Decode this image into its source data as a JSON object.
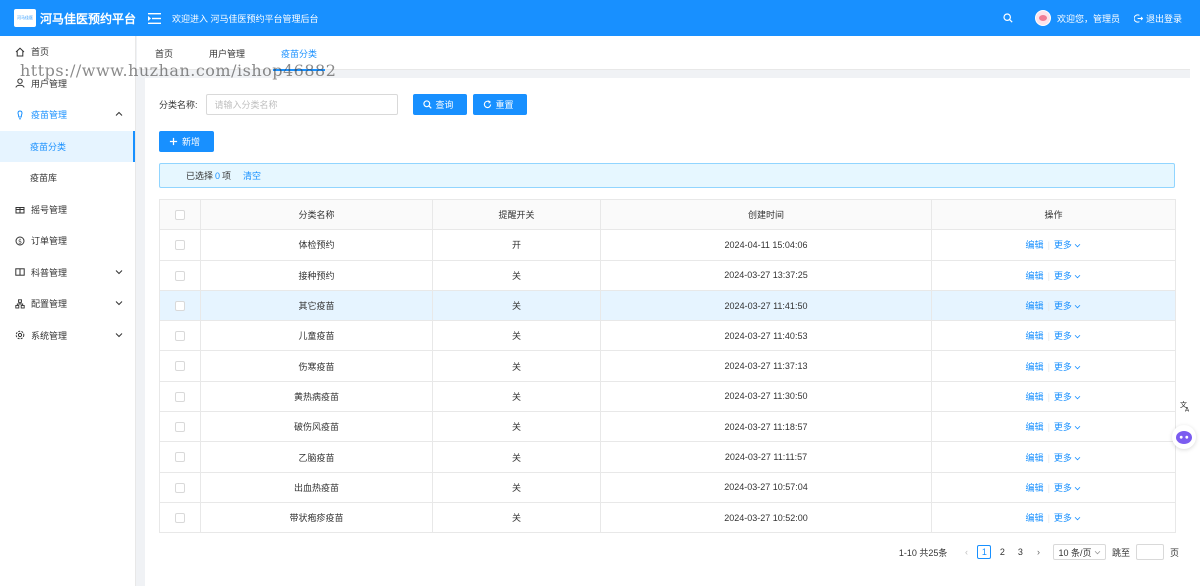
{
  "header": {
    "logo_text": "河马佳医",
    "title": "河马佳医预约平台",
    "welcome": "欢迎进入 河马佳医预约平台管理后台",
    "user": "欢迎您，管理员",
    "logout": "退出登录"
  },
  "watermark": "https://www.huzhan.com/ishop46882",
  "sidebar": {
    "home": "首页",
    "users": "用户管理",
    "vaccine": "疫苗管理",
    "vaccine_category": "疫苗分类",
    "vaccine_lib": "疫苗库",
    "number": "摇号管理",
    "orders": "订单管理",
    "science": "科普管理",
    "config": "配置管理",
    "system": "系统管理"
  },
  "tabs": [
    "首页",
    "用户管理",
    "疫苗分类"
  ],
  "filter": {
    "label": "分类名称:",
    "placeholder": "请输入分类名称",
    "query": "查询",
    "reset": "重置"
  },
  "add_button": "新增",
  "alert": {
    "selected_prefix": "已选择",
    "count": "0",
    "suffix": "项",
    "clear": "清空"
  },
  "table": {
    "headers": [
      "分类名称",
      "提醒开关",
      "创建时间",
      "操作"
    ],
    "rows": [
      {
        "name": "体检预约",
        "remind": "开",
        "time": "2024-04-11 15:04:06"
      },
      {
        "name": "接种预约",
        "remind": "关",
        "time": "2024-03-27 13:37:25"
      },
      {
        "name": "其它疫苗",
        "remind": "关",
        "time": "2024-03-27 11:41:50"
      },
      {
        "name": "儿童疫苗",
        "remind": "关",
        "time": "2024-03-27 11:40:53"
      },
      {
        "name": "伤寒疫苗",
        "remind": "关",
        "time": "2024-03-27 11:37:13"
      },
      {
        "name": "黄热病疫苗",
        "remind": "关",
        "time": "2024-03-27 11:30:50"
      },
      {
        "name": "破伤风疫苗",
        "remind": "关",
        "time": "2024-03-27 11:18:57"
      },
      {
        "name": "乙脑疫苗",
        "remind": "关",
        "time": "2024-03-27 11:11:57"
      },
      {
        "name": "出血热疫苗",
        "remind": "关",
        "time": "2024-03-27 10:57:04"
      },
      {
        "name": "带状疱疹疫苗",
        "remind": "关",
        "time": "2024-03-27 10:52:00"
      }
    ],
    "edit_label": "编辑",
    "more_label": "更多"
  },
  "pagination": {
    "total": "1-10 共25条",
    "pages": [
      "1",
      "2",
      "3"
    ],
    "page_size": "10 条/页",
    "jump_label": "跳至",
    "page_suffix": "页"
  }
}
